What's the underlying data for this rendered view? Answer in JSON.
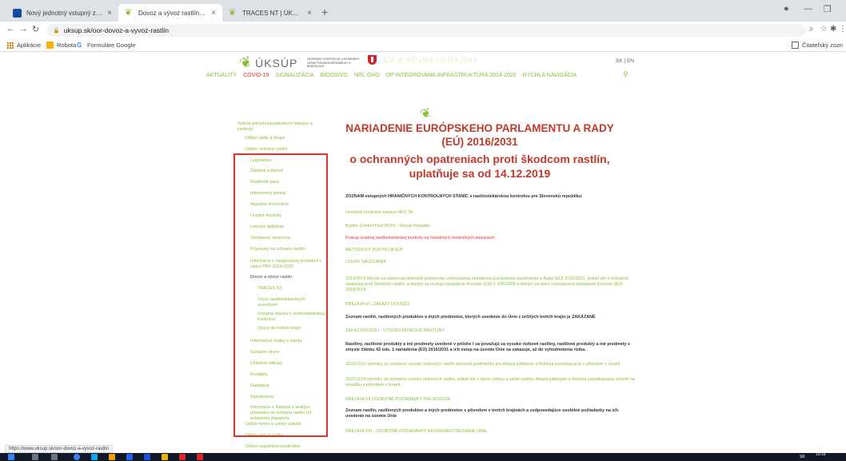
{
  "browser": {
    "tabs": [
      {
        "title": "Nový jednotný vstupný zdravotn",
        "close": "×"
      },
      {
        "title": "Dovoz a vývoz rastlín | ÚKSÚP",
        "close": "×"
      },
      {
        "title": "TRACES NT | ÚKSÚP",
        "close": "×"
      }
    ],
    "new_tab": "+",
    "url": "uksup.sk/oor-dovoz-a-vyvoz-rastlin",
    "bookmarks": [
      "Aplikácie",
      "Robota",
      "Formuláre Google"
    ],
    "reading_list": "Čitateľský zozn",
    "status_url": "https://www.uksup.sk/oor-dovoz-a-vyvoz-rastlin"
  },
  "site": {
    "logo_name": "ÚKSÚP",
    "logo_subtitle": "ÚSTREDNÝ KONTROLNÝ A SKÚŠOBNÝ ÚSTAV POĽNOHOSPODÁRSKY V BRATISLAVE",
    "ghost_text": "EÚ A VOJNY UKRAJINY",
    "lang": "SK | EN",
    "nav": [
      "AKTUALITY",
      "COVID-19",
      "SIGNALIZÁCIA",
      "BIOOSIVO",
      "NRL GHO",
      "OP INTEGROVANÁ INFRAŠTRUKTÚRA 2014-2020",
      "RÝCHLA NAVIGÁCIA"
    ]
  },
  "sidebar": [
    {
      "label": "Sekcia poľnohospodárskych vstupov a kontroly",
      "level": 0
    },
    {
      "label": "Odbor pôdy a hnojív",
      "level": 1
    },
    {
      "label": "Odbor ochrany rastlín",
      "level": 1
    },
    {
      "label": "Legislatíva",
      "level": 2
    },
    {
      "label": "Žiadosti a tlačivá",
      "level": 2
    },
    {
      "label": "Rastlinné pasy",
      "level": 2
    },
    {
      "label": "Internetový predaj",
      "level": 2
    },
    {
      "label": "Aktuálne informácie",
      "level": 2
    },
    {
      "label": "Úradné kontroly",
      "level": 2
    },
    {
      "label": "Letecké aplikácie",
      "level": 2
    },
    {
      "label": "Vyhlásené opatrenia",
      "level": 2
    },
    {
      "label": "Prípravky na ochranu rastlín",
      "level": 2
    },
    {
      "label": "Informácie k integrovanej produkcii v rámci PRV 2014-2020",
      "level": 2
    },
    {
      "label": "Dovoz a vývoz rastlín",
      "level": 2,
      "active": true
    },
    {
      "label": "TRACES NT",
      "level": 3
    },
    {
      "label": "Vzory rastlinolekárskych osvedčení",
      "level": 3
    },
    {
      "label": "Vstupné miesta s rastlinolekárskou kontrolou",
      "level": 3
    },
    {
      "label": "Vývoz do tretích krajín",
      "level": 3
    },
    {
      "label": "Informačné letáky a články",
      "level": 2
    },
    {
      "label": "Súčasne dreve",
      "level": 2
    },
    {
      "label": "Užitočné odkazy",
      "level": 2
    },
    {
      "label": "Kontakty",
      "level": 2
    },
    {
      "label": "Databáza",
      "level": 2
    },
    {
      "label": "Signalizácia",
      "level": 2
    },
    {
      "label": "Informácie k žiadosti o analýzu prípravku na ochranu rastlín od externého žiadateľa",
      "level": 2
    },
    {
      "label": "Odbor krmív a výživy zvierat",
      "level": 1
    },
    {
      "label": "Odbor osív a sadív",
      "level": 1
    },
    {
      "label": "Odbor registrácie pesticídov",
      "level": 1
    }
  ],
  "main": {
    "title": "NARIADENIE EURÓPSKEHO PARLAMENTU A RADY (EÚ) 2016/2031",
    "subtitle": "o ochranných opatreniach proti škodcom rastlín, uplatňuje sa od 14.12.2019",
    "content": [
      {
        "text": "ZOZNAM vstupných HRANIČNÝCH KONTROLNÝCH STANÍC s rastlinolekárskou kontrolou pre Slovenskú republiku:",
        "cls": "c-dark"
      },
      {
        "text": "Hraničné kontrolné stanice HKS SK",
        "cls": "c-green"
      },
      {
        "text": "Border Control Post BCPs - Slovak Republic",
        "cls": "c-green"
      },
      {
        "text": "Postup úradnej rastlinolekárskej kontroly na hraničných kontrolných staniciach:",
        "cls": "c-red"
      },
      {
        "text": "METODICKÝ POKYN ÚKSÚP",
        "cls": "c-green"
      },
      {
        "text": "COLNÝ SADZOBNÍK",
        "cls": "c-green"
      },
      {
        "text": "2019/2072 ktorým sa stanovujú jednotné podmienky vykonávania nariadenia Európskeho parlamentu a Rady (EÚ) 2016/2031, pokiaľ ide o ochranné opatrenia proti škodcom rastlín, a ktorým sa zrušuje nariadenie Komisie (ES) č. 690/2008 a ktorým sa mení vykonávacie nariadenie Komisie (EÚ) 2018/2019",
        "cls": "c-green"
      },
      {
        "text": "PRÍLOHA VI - ZÁKAZY DOVOZU",
        "cls": "c-green"
      },
      {
        "text": "Zoznam rastlín, rastlinných produktov a iných predmetov, ktorých uvedenie do Únie z určitých tretích krajín je ZAKÁZANÉ",
        "cls": "c-dark"
      },
      {
        "text": "ZÁKAZ DOVOZU - VYSOKO RIZIKOVÉ RASTLINY",
        "cls": "c-green"
      },
      {
        "text": "Rastliny, rastlinné produkty a iné predmety uvedené v prílohe I sa považujú za vysoko rizikové rastliny, rastlinné produkty a iné predmety v zmysle článku 42 ods. 1 nariadenia (EÚ) 2016/2031 a ich vstup na územie Únie sa zakazuje, až do vyhodnotenia rizika.",
        "cls": "c-dark"
      },
      {
        "text": "2020/1213 výnimky zo zoznamu vysoko rizikových rastlín dovozné podmienky pre Albizia julibrissin a Robinia pseudoacacia s pôvodom v Izraeli",
        "cls": "c-green"
      },
      {
        "text": "2020/1214 výnimky zo zoznamu vysoko rizikových rastlín, pokiaľ ide o drevo Ulmus s určité rastliny Albizia julibrissin a Robinia pseudoacacia určené na výsadbu s pôvodom v Izraeli",
        "cls": "c-green"
      },
      {
        "text": "PRÍLOHA VII OSOBITNÉ POŽIADAVKY PRI DOVOZE",
        "cls": "c-green"
      },
      {
        "text": "Zoznam rastlín, rastlinných produktov a iných predmetov s pôvodom v tretích krajinách a zodpovedajúce osobitné požiadavky na ich uvedenie na územie Únie",
        "cls": "c-dark"
      },
      {
        "text": "PRÍLOHA XIII - OSOBITNÉ POŽIADAVKY NA PREMIESTŇOVANIE ÚNIE",
        "cls": "c-green"
      }
    ]
  },
  "taskbar": {
    "lang": "SK",
    "time": "10:16"
  },
  "colors": {
    "green": "#8bbd3a",
    "red": "#c0392b",
    "highlight_border": "#d8342b"
  }
}
